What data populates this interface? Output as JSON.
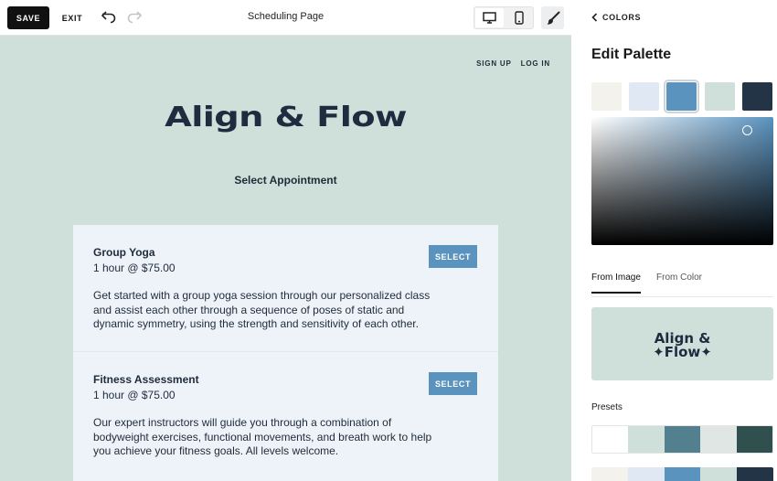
{
  "toolbar": {
    "save_label": "SAVE",
    "exit_label": "EXIT",
    "page_title": "Scheduling Page"
  },
  "site": {
    "nav": [
      "SIGN UP",
      "LOG IN"
    ],
    "logo": "Align & Flow",
    "heading": "Select Appointment",
    "appointments": [
      {
        "name": "Group Yoga",
        "meta": "1 hour @ $75.00",
        "description": "Get started with a group yoga session through our personalized class and assist each other through a sequence of poses of static and dynamic symmetry, using the strength and sensitivity of each other.",
        "button": "SELECT"
      },
      {
        "name": "Fitness Assessment",
        "meta": "1 hour @ $75.00",
        "description": "Our expert instructors will guide you through a combination of bodyweight exercises, functional movements, and breath work to help you achieve your fitness goals. All levels welcome.",
        "button": "SELECT"
      }
    ]
  },
  "panel": {
    "back_label": "COLORS",
    "title": "Edit Palette",
    "palette": [
      "#f4f2ec",
      "#dfe8f3",
      "#5b93bf",
      "#cfdfd9",
      "#243447"
    ],
    "selected_swatch": 2,
    "tabs": [
      "From Image",
      "From Color"
    ],
    "active_tab": "From Image",
    "image_logo_line1": "Align &",
    "image_logo_line2": "✦Flow✦",
    "presets_label": "Presets",
    "presets": [
      [
        "#ffffff",
        "#cfdfd9",
        "#53808f",
        "#dfe6e4",
        "#30504f"
      ],
      [
        "#f4f2ec",
        "#dfe8f3",
        "#5b93bf",
        "#cfdfd9",
        "#243447"
      ]
    ]
  }
}
